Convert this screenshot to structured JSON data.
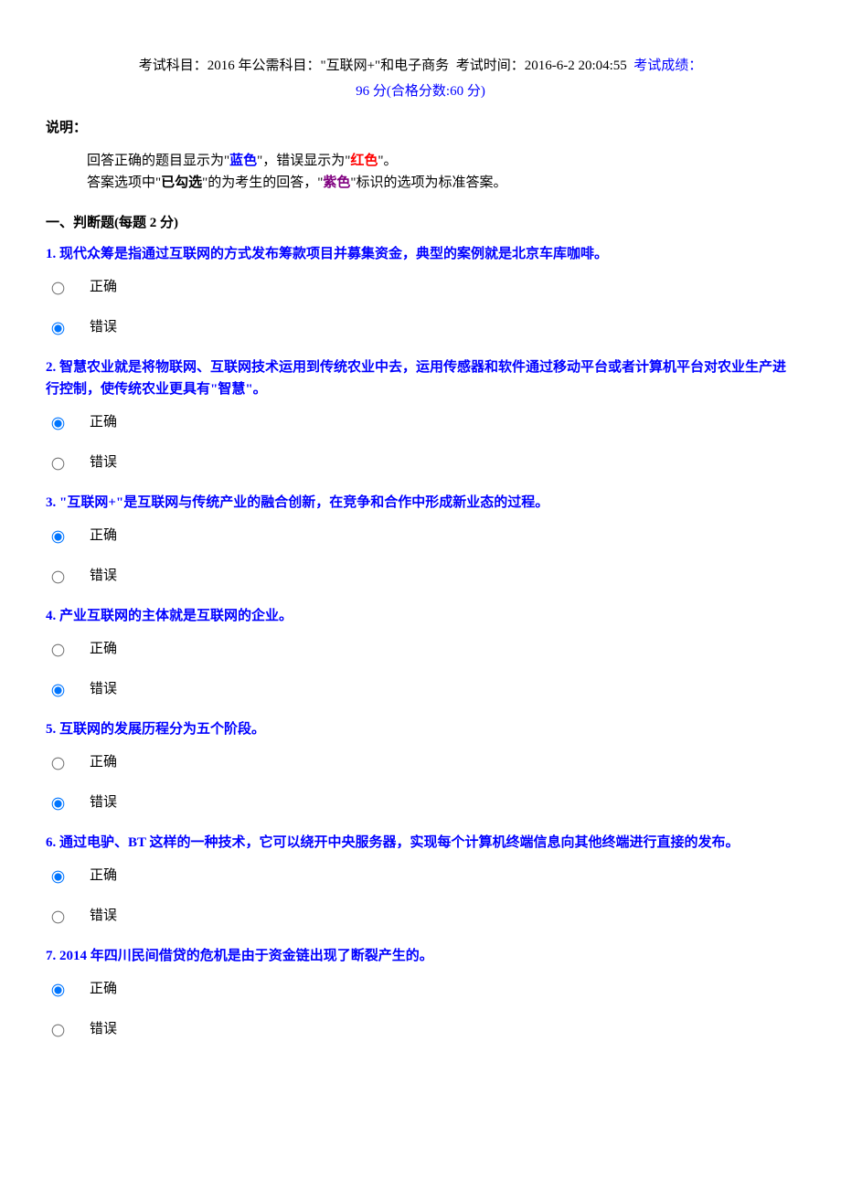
{
  "header": {
    "subject_label": "考试科目：",
    "subject_value": "2016 年公需科目：\"互联网+\"和电子商务",
    "time_label": "考试时间：",
    "time_value": "2016-6-2 20:04:55",
    "score_label": "考试成绩：",
    "score_value": "96 分",
    "pass_text": "(合格分数:60 分)"
  },
  "instructions": {
    "label": "说明：",
    "line1_pre": "回答正确的题目显示为\"",
    "line1_blue": "蓝色",
    "line1_mid": "\"，错误显示为\"",
    "line1_red": "红色",
    "line1_post": "\"。",
    "line2_pre": "答案选项中\"",
    "line2_bold": "已勾选",
    "line2_mid": "\"的为考生的回答，\"",
    "line2_purple": "紫色",
    "line2_post": "\"标识的选项为标准答案。"
  },
  "section": {
    "title": "一、判断题(每题 2 分)"
  },
  "labels": {
    "correct": "正确",
    "wrong": "错误"
  },
  "questions": [
    {
      "num": "1.",
      "text": "现代众筹是指通过互联网的方式发布筹款项目并募集资金，典型的案例就是北京车库咖啡。",
      "selected": 1
    },
    {
      "num": "2.",
      "text": "智慧农业就是将物联网、互联网技术运用到传统农业中去，运用传感器和软件通过移动平台或者计算机平台对农业生产进行控制，使传统农业更具有\"智慧\"。",
      "selected": 0
    },
    {
      "num": "3.",
      "text": "\"互联网+\"是互联网与传统产业的融合创新，在竞争和合作中形成新业态的过程。",
      "selected": 0
    },
    {
      "num": "4.",
      "text": "产业互联网的主体就是互联网的企业。",
      "selected": 1
    },
    {
      "num": "5.",
      "text": "互联网的发展历程分为五个阶段。",
      "selected": 1
    },
    {
      "num": "6.",
      "text": "通过电驴、BT 这样的一种技术，它可以绕开中央服务器，实现每个计算机终端信息向其他终端进行直接的发布。",
      "selected": 0
    },
    {
      "num": "7.",
      "text": "2014 年四川民间借贷的危机是由于资金链出现了断裂产生的。",
      "selected": 0
    }
  ]
}
